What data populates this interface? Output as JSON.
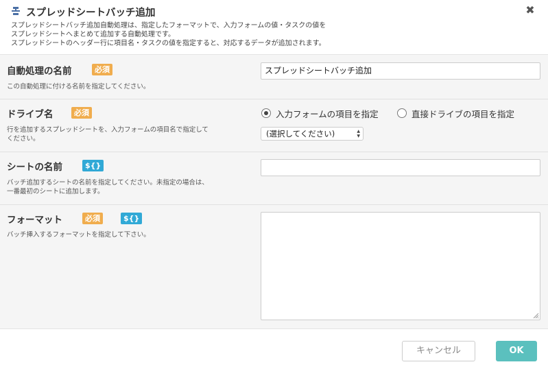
{
  "dialog": {
    "title": "スプレッドシートバッチ追加",
    "icon": "spreadsheet-batch-icon",
    "description": [
      "スプレッドシートバッチ追加自動処理は、指定したフォーマットで、入力フォームの値・タスクの値を",
      "スプレッドシートへまとめて追加する自動処理です。",
      "スプレッドシートのヘッダー行に項目名・タスクの値を指定すると、対応するデータが追加されます。"
    ],
    "close_symbol": "✖"
  },
  "badges": {
    "required": "必須",
    "variable": "${}"
  },
  "fields": {
    "name": {
      "label": "自動処理の名前",
      "help": [
        "この自動処理に付ける名前を指定してください。"
      ],
      "value": "スプレッドシートバッチ追加"
    },
    "drive": {
      "label": "ドライブ名",
      "help": [
        "行を追加するスプレッドシートを、入力フォームの項目名で指定して",
        "ください。"
      ],
      "radio_form": "入力フォームの項目を指定",
      "radio_direct": "直接ドライブの項目を指定",
      "selected": "form",
      "select_value": "(選択してください)"
    },
    "sheet": {
      "label": "シートの名前",
      "help": [
        "バッチ追加するシートの名前を指定してください。未指定の場合は、",
        "一番最初のシートに追加します。"
      ],
      "value": ""
    },
    "format": {
      "label": "フォーマット",
      "help": [
        "バッチ挿入するフォーマットを指定して下さい。"
      ],
      "value": ""
    }
  },
  "footer": {
    "cancel_label": "キャンセル",
    "ok_label": "OK"
  },
  "colors": {
    "required_badge": "#f0ad4e",
    "variable_badge": "#31a9d6",
    "ok_button": "#5bc0be"
  }
}
